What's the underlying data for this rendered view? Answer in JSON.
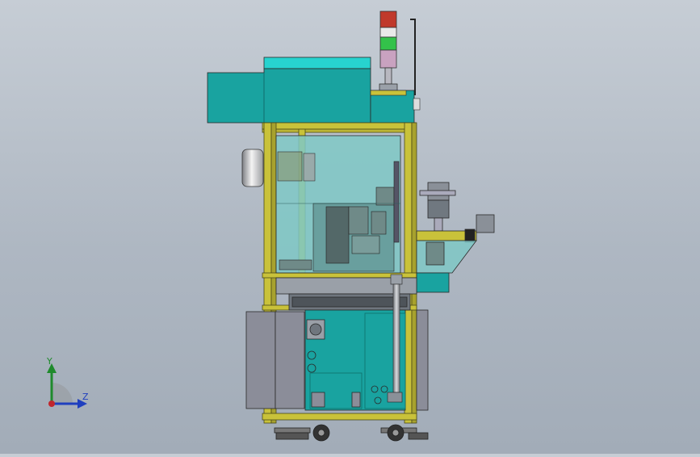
{
  "view": {
    "background": [
      "#c6cdd5",
      "#a2acb8"
    ],
    "model": "machine-assembly-side-view"
  },
  "colors": {
    "teal": "#1aa3a0",
    "cyan_top": "#27d3cf",
    "frame_yellow": "#c9c23a",
    "glass": "#7fc8c6",
    "cabinet_grey": "#8b8d99",
    "beacon_red": "#c0392b",
    "beacon_green": "#33c24a",
    "beacon_pink": "#c9a2c0"
  },
  "triad": {
    "y_label": "Y",
    "z_label": "Z",
    "icons": [
      "y-axis-arrow-icon",
      "z-axis-arrow-icon",
      "x-axis-dot-icon"
    ]
  }
}
